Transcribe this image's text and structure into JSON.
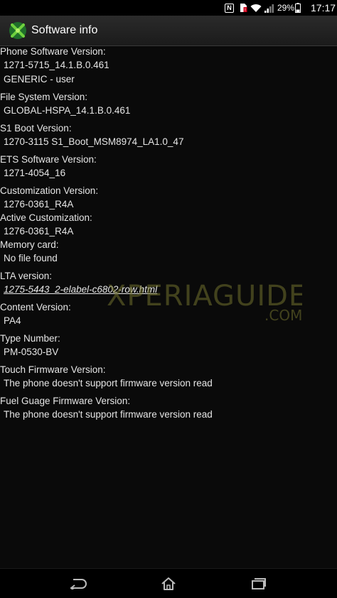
{
  "status_bar": {
    "icons": [
      "nfc-icon",
      "sim-error-icon",
      "wifi-icon",
      "signal-icon",
      "battery-icon"
    ],
    "battery": "29%",
    "time": "17:17"
  },
  "action_bar": {
    "app_icon": "settings-tools-icon",
    "title": "Software info"
  },
  "entries": [
    {
      "label": "Phone Software Version:",
      "values": [
        "1271-5715_14.1.B.0.461",
        "GENERIC - user"
      ]
    },
    {
      "label": "File System Version:",
      "values": [
        "GLOBAL-HSPA_14.1.B.0.461"
      ]
    },
    {
      "label": "S1 Boot Version:",
      "values": [
        "1270-3115 S1_Boot_MSM8974_LA1.0_47"
      ]
    },
    {
      "label": "ETS Software Version:",
      "values": [
        "1271-4054_16"
      ]
    },
    {
      "label": "Customization Version:",
      "values": [
        "1276-0361_R4A"
      ]
    },
    {
      "label": "Active Customization:",
      "values": [
        "1276-0361_R4A"
      ]
    },
    {
      "label": "Memory card:",
      "values": [
        "No file found"
      ]
    },
    {
      "label": "LTA version:",
      "values": [
        "1275-5443_2-elabel-c6802-row.html"
      ]
    },
    {
      "label": "Content Version:",
      "values": [
        "PA4"
      ]
    },
    {
      "label": "Type Number:",
      "values": [
        "PM-0530-BV"
      ]
    },
    {
      "label": "Touch Firmware Version:",
      "values": [
        "The phone doesn't support firmware version read"
      ]
    },
    {
      "label": "Fuel Guage Firmware Version:",
      "values": [
        "The phone doesn't support firmware version read"
      ]
    }
  ],
  "watermark": {
    "text": "XPERIAGUIDE",
    "sub": ".COM"
  },
  "nav_bar": {
    "icons": [
      "back-icon",
      "home-icon",
      "recent-apps-icon"
    ]
  },
  "colors": {
    "background": "#0a0a0a",
    "text": "#e6e6e6",
    "watermark": "#7a7a30"
  }
}
